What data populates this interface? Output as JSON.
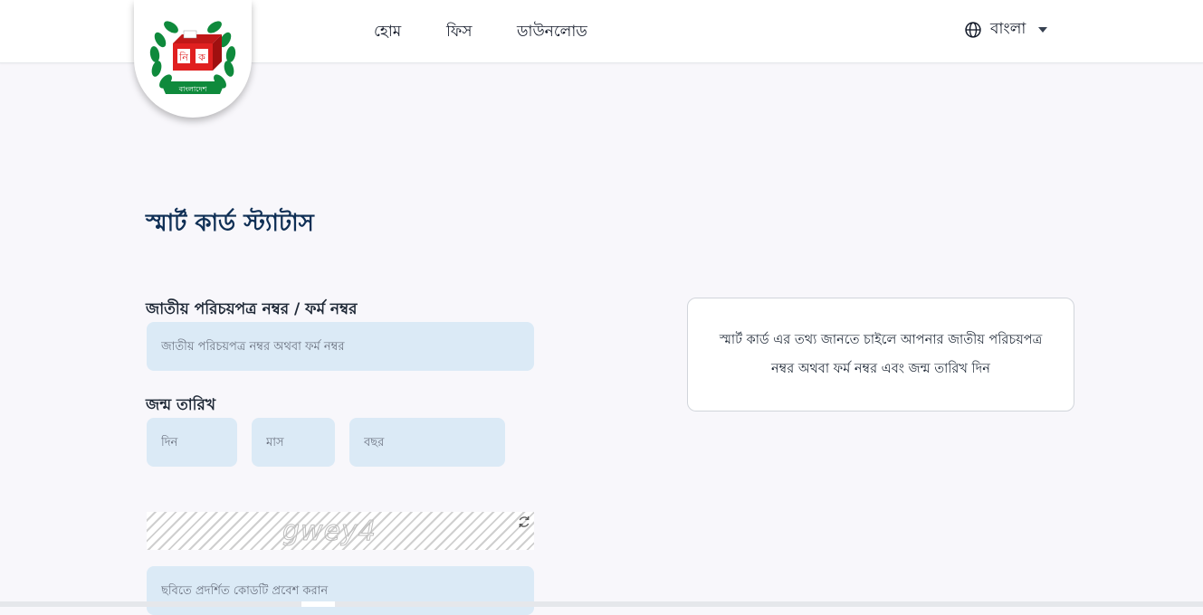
{
  "header": {
    "logo": {
      "icon": "ballot-box-emblem-icon",
      "ballot_left": "নি",
      "ballot_right": "ক",
      "ribbon_text": "বাংলাদেশ",
      "colors": {
        "wreath": "#0f8a3c",
        "box": "#e02020",
        "ribbon": "#0f8a3c"
      }
    },
    "nav": [
      {
        "label": "হোম"
      },
      {
        "label": "ফিস"
      },
      {
        "label": "ডাউনলোড"
      }
    ],
    "language": {
      "icon": "globe-icon",
      "label": "বাংলা",
      "caret_icon": "caret-down-icon"
    }
  },
  "main": {
    "title": "স্মার্ট কার্ড স্ট্যাটাস",
    "nid_label": "জাতীয় পরিচয়পত্র নম্বর / ফর্ম নম্বর",
    "nid_placeholder": "জাতীয় পরিচয়পত্র নম্বর অথবা ফর্ম নম্বর",
    "dob_label": "জন্ম তারিখ",
    "day_placeholder": "দিন",
    "month_placeholder": "মাস",
    "year_placeholder": "বছর",
    "captcha_text": "gwey4",
    "captcha_refresh_icon": "refresh-icon",
    "captcha_placeholder": "ছবিতে প্রদর্শিত কোডটি প্রবেশ করান"
  },
  "info_box": {
    "text": "স্মার্ট কার্ড এর তথ্য জানতে চাইলে আপনার জাতীয় পরিচয়পত্র নম্বর অথবা ফর্ম নম্বর এবং জন্ম তারিখ দিন"
  },
  "colors": {
    "title": "#0f2f55",
    "input_bg": "#dbeaf6",
    "page_bg": "#f8f7fb"
  }
}
